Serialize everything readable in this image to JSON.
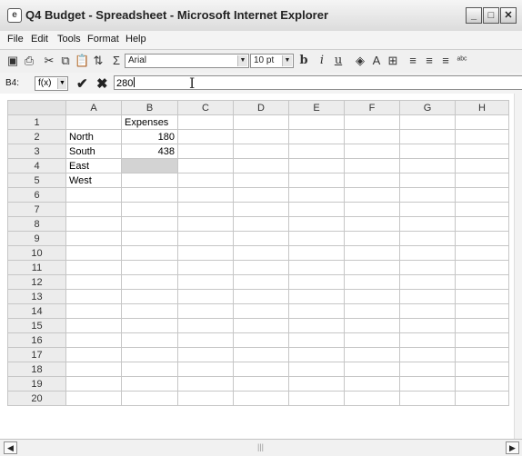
{
  "window": {
    "title": "Q4 Budget - Spreadsheet - Microsoft Internet Explorer",
    "controls": [
      "minimize",
      "maximize",
      "close"
    ]
  },
  "menubar": {
    "items": [
      "File",
      "Edit",
      "Tools",
      "Format",
      "Help"
    ]
  },
  "toolbar": {
    "icons": [
      "save-icon",
      "print-icon",
      "cut-icon",
      "copy-icon",
      "paste-icon",
      "sort-icon",
      "sum-icon",
      "bold-icon",
      "italic-icon",
      "underline-icon",
      "fill-color-icon",
      "font-color-icon",
      "borders-icon",
      "align-left-icon",
      "align-center-icon",
      "align-right-icon",
      "spell-check-icon"
    ],
    "font_name": "Arial",
    "font_size": "10 pt",
    "bold_label": "b",
    "italic_label": "i",
    "underline_label": "u"
  },
  "formulabar": {
    "cell_ref": "B4:",
    "function_label": "f(x)",
    "value": "280"
  },
  "sheet": {
    "columns": [
      "A",
      "B",
      "C",
      "D",
      "E",
      "F",
      "G",
      "H"
    ],
    "rows": [
      {
        "num": "1",
        "cells": [
          "",
          "Expenses",
          "",
          "",
          "",
          "",
          "",
          ""
        ]
      },
      {
        "num": "2",
        "cells": [
          "North",
          "180",
          "",
          "",
          "",
          "",
          "",
          ""
        ]
      },
      {
        "num": "3",
        "cells": [
          "South",
          "438",
          "",
          "",
          "",
          "",
          "",
          ""
        ]
      },
      {
        "num": "4",
        "cells": [
          "East",
          "",
          "",
          "",
          "",
          "",
          "",
          ""
        ]
      },
      {
        "num": "5",
        "cells": [
          "West",
          "",
          "",
          "",
          "",
          "",
          "",
          ""
        ]
      },
      {
        "num": "6",
        "cells": [
          "",
          "",
          "",
          "",
          "",
          "",
          "",
          ""
        ]
      },
      {
        "num": "7",
        "cells": [
          "",
          "",
          "",
          "",
          "",
          "",
          "",
          ""
        ]
      },
      {
        "num": "8",
        "cells": [
          "",
          "",
          "",
          "",
          "",
          "",
          "",
          ""
        ]
      },
      {
        "num": "9",
        "cells": [
          "",
          "",
          "",
          "",
          "",
          "",
          "",
          ""
        ]
      },
      {
        "num": "10",
        "cells": [
          "",
          "",
          "",
          "",
          "",
          "",
          "",
          ""
        ]
      },
      {
        "num": "11",
        "cells": [
          "",
          "",
          "",
          "",
          "",
          "",
          "",
          ""
        ]
      },
      {
        "num": "12",
        "cells": [
          "",
          "",
          "",
          "",
          "",
          "",
          "",
          ""
        ]
      },
      {
        "num": "13",
        "cells": [
          "",
          "",
          "",
          "",
          "",
          "",
          "",
          ""
        ]
      },
      {
        "num": "14",
        "cells": [
          "",
          "",
          "",
          "",
          "",
          "",
          "",
          ""
        ]
      },
      {
        "num": "15",
        "cells": [
          "",
          "",
          "",
          "",
          "",
          "",
          "",
          ""
        ]
      },
      {
        "num": "16",
        "cells": [
          "",
          "",
          "",
          "",
          "",
          "",
          "",
          ""
        ]
      },
      {
        "num": "17",
        "cells": [
          "",
          "",
          "",
          "",
          "",
          "",
          "",
          ""
        ]
      },
      {
        "num": "18",
        "cells": [
          "",
          "",
          "",
          "",
          "",
          "",
          "",
          ""
        ]
      },
      {
        "num": "19",
        "cells": [
          "",
          "",
          "",
          "",
          "",
          "",
          "",
          ""
        ]
      },
      {
        "num": "20",
        "cells": [
          "",
          "",
          "",
          "",
          "",
          "",
          "",
          ""
        ]
      }
    ],
    "numeric_cells": [
      "B2",
      "B3"
    ],
    "selected_cell": "B4",
    "selected_color": "#d3d3d3"
  }
}
